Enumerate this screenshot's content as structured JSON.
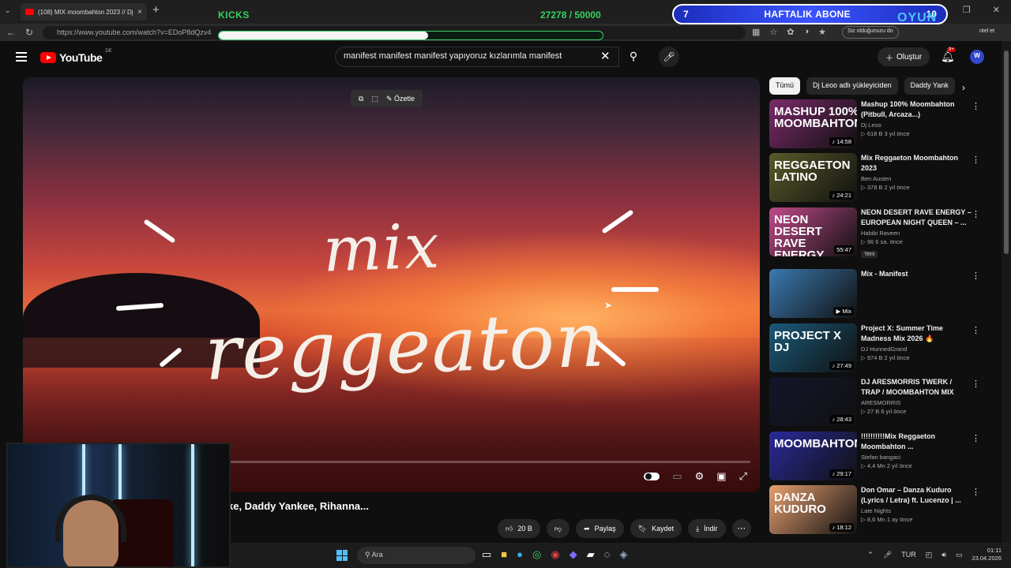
{
  "browser": {
    "tab_title": "(108) MIX moombahton 2023 // Dj",
    "tab_close": "×",
    "new_tab": "+",
    "url": "https://www.youtube.com/watch?v=EDoP8dQzv4",
    "profile_text": "Siz olduğunuzu do",
    "profile_suffix": "otel et"
  },
  "overlay": {
    "kicks_label": "KICKS",
    "kicks_count": "27278 / 50000",
    "kicks_progress": 0.545,
    "weekly_left": "7",
    "weekly_label": "HAFTALIK ABONE",
    "weekly_right": "10",
    "brand": "OYUN"
  },
  "header": {
    "logo_text": "YouTube",
    "country": "DE",
    "search_value": "manifest manifest manifest yapıyoruz kızlarımla manifest",
    "create_label": "Oluştur",
    "notif_count": "9+",
    "avatar": "W"
  },
  "player": {
    "ozetle_label": "Özetle",
    "line1": "mix",
    "line2": "reggeaton"
  },
  "video": {
    "title": "ke, Daddy Yankee, Rihanna...",
    "like_count": "20 B",
    "share_label": "Paylaş",
    "save_label": "Kaydet",
    "download_label": "İndir",
    "more": "⋯"
  },
  "chips": [
    "Tümü",
    "Dj Leoo adlı yükleyiciden",
    "Daddy Yank"
  ],
  "suggestions": [
    {
      "thumb_text": "MASHUP 100% MOOMBAHTON",
      "title": "Mashup 100% Moombahton (Pitbull, Arcaza...)",
      "channel": "Dj Leoo",
      "stats": "▷ 618 B  3 yıl önce",
      "duration": "♪ 14:58",
      "bg": "#7a2a6a"
    },
    {
      "thumb_text": "REGGAETON LATINO",
      "title": "Mix Reggaeton Moombahton 2023",
      "channel": "Ben Austen",
      "stats": "▷ 378 B  2 yıl önce",
      "duration": "♪ 24:21",
      "bg": "#5a5a2a"
    },
    {
      "thumb_text": "NEON DESERT RAVE ENERGY",
      "title": "NEON DESERT RAVE ENERGY – EUROPEAN NIGHT QUEEN – ...",
      "channel": "Habibi Raveen",
      "stats": "▷ 96  6 sa. önce",
      "duration": "55:47",
      "badge": "Yeni",
      "bg": "#c04a8a"
    },
    {
      "thumb_text": "",
      "title": "Mix - Manifest",
      "channel": "",
      "stats": "",
      "duration": "▶ Mix",
      "bg": "#3a7ab0"
    },
    {
      "thumb_text": "PROJECT X DJ",
      "title": "Project X: Summer Time Madness Mix 2026 🔥",
      "channel": "DJ HunnedGrand",
      "stats": "▷ 974 B  2 yıl önce",
      "duration": "♪ 27:49",
      "bg": "#1a5a7a"
    },
    {
      "thumb_text": "",
      "title": "DJ ARESMORRIS TWERK / TRAP / MOOMBAHTON MIX",
      "channel": "ARESMORRIS",
      "stats": "▷ 27 B  6 yıl önce",
      "duration": "♪ 28:43",
      "bg": "#12162a"
    },
    {
      "thumb_text": "MOOMBAHTON",
      "title": "!!!!!!!!!!Mix Reggaeton Moombahton ...",
      "channel": "Stefan bangaci",
      "stats": "▷ 4,4 Mn  2 yıl önce",
      "duration": "♪ 29:17",
      "bg": "#2a2a9a"
    },
    {
      "thumb_text": "DANZA KUDURO",
      "title": "Don Omar – Danza Kuduro (Lyrics / Letra) ft. Lucenzo | ...",
      "channel": "Late Nights",
      "stats": "▷ 8,6 Mn  1 ay önce",
      "duration": "♪ 18:12",
      "bg": "#e8a070"
    }
  ],
  "taskbar": {
    "search_placeholder": "Ara",
    "lang": "TUR",
    "time": "01:11",
    "date": "23.04.2026"
  }
}
